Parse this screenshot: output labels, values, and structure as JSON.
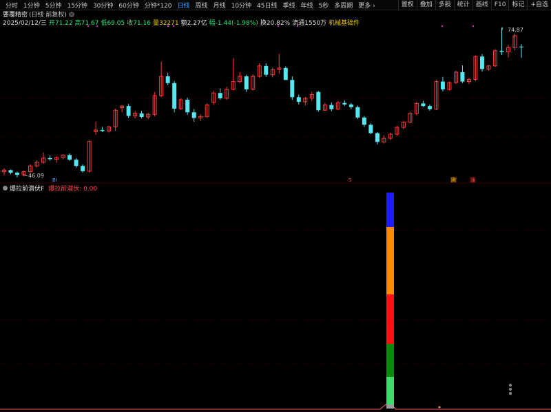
{
  "toolbar": {
    "periods": [
      "分时",
      "1分钟",
      "5分钟",
      "15分钟",
      "30分钟",
      "60分钟",
      "分钟*120",
      "日线",
      "周线",
      "月线",
      "10分钟",
      "45日线",
      "季线",
      "年线",
      "5秒",
      "多周期",
      "更多"
    ],
    "active_index": 7,
    "more_arrow": "›",
    "right_tools": [
      "置权",
      "叠加",
      "多股",
      "统计",
      "画线",
      "F10",
      "标记",
      "+自选"
    ]
  },
  "stock": {
    "name": "要覆精密",
    "sub": "(日线 前复权)",
    "close_icon": "close-icon"
  },
  "quote": {
    "date": "2025/02/12/三",
    "open": "开71.22",
    "high": "高71.67",
    "low": "低69.05",
    "close": "收71.16",
    "volume": "量32271",
    "amount": "额2.27亿",
    "change": "幅-1.44(-1.98%)",
    "turnover": "换20.82%",
    "float": "流通1550万",
    "concept": "机械基础件"
  },
  "price_labels": {
    "high": "74.87",
    "low": "46.09"
  },
  "markers": {
    "b": "BI",
    "s": "S",
    "teng": "腾",
    "zhang": "涨"
  },
  "indicator": {
    "name": "爆拉前潜伏F",
    "label": "爆拉前潜伏: 0.00"
  },
  "colors": {
    "up": "#ff3b3b",
    "down": "#55e6f0",
    "bg": "#000000",
    "grid": "#2a0000",
    "active": "#3aa2ff"
  },
  "chart_data": {
    "type": "candlestick",
    "ohlc": [
      [
        47.2,
        47.8,
        46.5,
        47.5
      ],
      [
        47.5,
        47.6,
        46.7,
        47.0
      ],
      [
        47.0,
        47.2,
        46.1,
        46.6
      ],
      [
        46.6,
        47.4,
        46.3,
        47.2
      ],
      [
        47.2,
        48.6,
        47.0,
        48.3
      ],
      [
        48.3,
        49.4,
        48.0,
        49.0
      ],
      [
        49.0,
        50.9,
        48.7,
        49.8
      ],
      [
        49.8,
        50.3,
        49.3,
        49.6
      ],
      [
        49.6,
        50.2,
        48.9,
        49.9
      ],
      [
        49.9,
        50.6,
        49.5,
        50.4
      ],
      [
        50.4,
        50.7,
        49.3,
        49.5
      ],
      [
        49.5,
        49.8,
        48.0,
        48.3
      ],
      [
        48.3,
        48.6,
        47.0,
        47.3
      ],
      [
        47.3,
        53.2,
        47.0,
        53.0
      ],
      [
        54.9,
        56.8,
        54.3,
        55.2
      ],
      [
        55.2,
        55.8,
        54.8,
        55.0
      ],
      [
        55.0,
        56.0,
        54.7,
        55.8
      ],
      [
        55.8,
        59.3,
        55.0,
        59.0
      ],
      [
        59.5,
        60.0,
        58.6,
        59.8
      ],
      [
        59.8,
        60.2,
        57.5,
        57.9
      ],
      [
        57.9,
        58.8,
        57.4,
        58.4
      ],
      [
        58.4,
        58.9,
        57.4,
        57.7
      ],
      [
        57.7,
        58.5,
        57.3,
        58.2
      ],
      [
        58.2,
        62.5,
        57.8,
        61.8
      ],
      [
        61.8,
        68.3,
        61.5,
        65.5
      ],
      [
        65.5,
        66.2,
        63.8,
        64.2
      ],
      [
        64.2,
        64.6,
        58.6,
        59.3
      ],
      [
        59.3,
        61.3,
        59.0,
        61.0
      ],
      [
        61.0,
        61.4,
        58.1,
        58.6
      ],
      [
        58.6,
        59.2,
        56.8,
        57.5
      ],
      [
        57.5,
        58.2,
        56.9,
        57.8
      ],
      [
        57.8,
        60.3,
        57.5,
        60.0
      ],
      [
        60.5,
        62.7,
        60.0,
        62.3
      ],
      [
        62.3,
        63.2,
        61.0,
        61.3
      ],
      [
        61.3,
        63.5,
        61.0,
        63.0
      ],
      [
        63.0,
        69.0,
        62.8,
        64.5
      ],
      [
        64.5,
        66.3,
        64.2,
        65.5
      ],
      [
        65.5,
        65.8,
        62.5,
        63.0
      ],
      [
        63.0,
        65.9,
        62.8,
        65.5
      ],
      [
        65.5,
        68.0,
        65.2,
        67.5
      ],
      [
        67.5,
        68.0,
        65.4,
        65.8
      ],
      [
        65.8,
        67.2,
        65.3,
        66.8
      ],
      [
        66.8,
        69.8,
        66.0,
        67.1
      ],
      [
        67.1,
        67.4,
        64.8,
        64.8
      ],
      [
        64.8,
        65.5,
        61.0,
        61.5
      ],
      [
        61.5,
        62.0,
        60.1,
        60.6
      ],
      [
        60.6,
        61.5,
        59.9,
        61.3
      ],
      [
        61.3,
        62.5,
        60.8,
        62.0
      ],
      [
        62.5,
        62.7,
        58.7,
        59.0
      ],
      [
        59.0,
        60.4,
        58.9,
        60.0
      ],
      [
        60.0,
        60.5,
        58.8,
        59.2
      ],
      [
        59.2,
        60.8,
        59.0,
        60.4
      ],
      [
        60.4,
        60.9,
        59.8,
        60.1
      ],
      [
        60.1,
        60.4,
        59.2,
        59.6
      ],
      [
        59.6,
        59.9,
        57.3,
        57.6
      ],
      [
        57.6,
        57.9,
        55.8,
        56.2
      ],
      [
        56.2,
        56.5,
        54.4,
        54.6
      ],
      [
        54.6,
        54.8,
        52.4,
        52.9
      ],
      [
        52.9,
        54.2,
        52.6,
        53.6
      ],
      [
        53.6,
        54.7,
        53.3,
        54.4
      ],
      [
        54.4,
        56.0,
        54.1,
        55.7
      ],
      [
        55.7,
        57.0,
        55.4,
        56.7
      ],
      [
        56.7,
        58.7,
        56.5,
        58.4
      ],
      [
        58.4,
        60.5,
        58.0,
        60.3
      ],
      [
        60.3,
        60.8,
        59.6,
        59.8
      ],
      [
        59.8,
        60.1,
        58.9,
        59.2
      ],
      [
        59.2,
        64.8,
        59.0,
        64.5
      ],
      [
        64.5,
        65.4,
        62.6,
        63.0
      ],
      [
        63.0,
        64.5,
        62.8,
        64.3
      ],
      [
        64.3,
        66.6,
        64.0,
        66.3
      ],
      [
        66.3,
        67.6,
        64.2,
        64.5
      ],
      [
        64.5,
        65.2,
        64.0,
        64.9
      ],
      [
        64.9,
        69.5,
        64.6,
        69.3
      ],
      [
        69.3,
        69.8,
        66.4,
        66.9
      ],
      [
        66.9,
        67.7,
        66.6,
        67.5
      ],
      [
        67.5,
        70.7,
        67.3,
        70.4
      ],
      [
        70.4,
        74.9,
        69.6,
        70.2
      ],
      [
        70.2,
        71.6,
        69.1,
        71.0
      ],
      [
        71.0,
        73.7,
        70.5,
        73.3
      ],
      [
        71.2,
        71.67,
        69.05,
        71.16
      ]
    ],
    "indicator": {
      "name": "爆拉前潜伏F",
      "value": 0.0,
      "segments": [
        "#1c1cff",
        "#ff8a00",
        "#ff1010",
        "#0a8a0a",
        "#3ddc6a"
      ]
    }
  }
}
